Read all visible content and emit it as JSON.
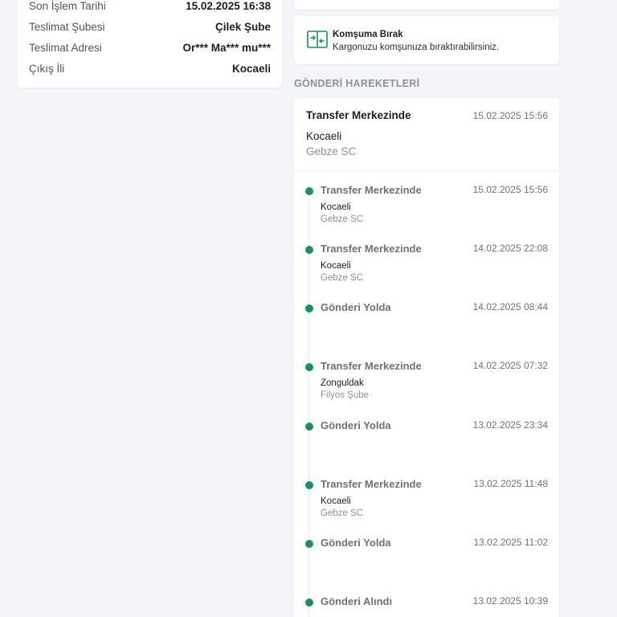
{
  "shipment_info": {
    "rows": [
      {
        "label": "Son İşlem Tarihi",
        "value": "15.02.2025 16:38"
      },
      {
        "label": "Teslimat Şubesi",
        "value": "Çilek Şube"
      },
      {
        "label": "Teslimat Adresi",
        "value": "Or*** Ma*** mu***"
      },
      {
        "label": "Çıkış İli",
        "value": "Kocaeli"
      }
    ]
  },
  "neighbor_option": {
    "icon": "neighbor-transfer-icon",
    "title": "Komşuma Bırak",
    "subtitle": "Kargonuzu komşunuza bıraktırabilirsiniz."
  },
  "movements": {
    "section_title": "GÖNDERİ HAREKETLERİ",
    "latest": {
      "status": "Transfer Merkezinde",
      "date": "15.02.2025 15:56",
      "city": "Kocaeli",
      "branch": "Gebze SC"
    },
    "events": [
      {
        "status": "Transfer Merkezinde",
        "date": "15.02.2025 15:56",
        "city": "Kocaeli",
        "branch": "Gebze SC"
      },
      {
        "status": "Transfer Merkezinde",
        "date": "14.02.2025 22:08",
        "city": "Kocaeli",
        "branch": "Gebze SC"
      },
      {
        "status": "Gönderi Yolda",
        "date": "14.02.2025 08:44",
        "city": "",
        "branch": ""
      },
      {
        "status": "Transfer Merkezinde",
        "date": "14.02.2025 07:32",
        "city": "Zonguldak",
        "branch": "Filyos Şube"
      },
      {
        "status": "Gönderi Yolda",
        "date": "13.02.2025 23:34",
        "city": "",
        "branch": ""
      },
      {
        "status": "Transfer Merkezinde",
        "date": "13.02.2025 11:48",
        "city": "Kocaeli",
        "branch": "Gebze SC"
      },
      {
        "status": "Gönderi Yolda",
        "date": "13.02.2025 11:02",
        "city": "",
        "branch": ""
      },
      {
        "status": "Gönderi Alındı",
        "date": "13.02.2025 10:39",
        "city": "",
        "branch": ""
      }
    ],
    "accent_color": "#17935a"
  }
}
